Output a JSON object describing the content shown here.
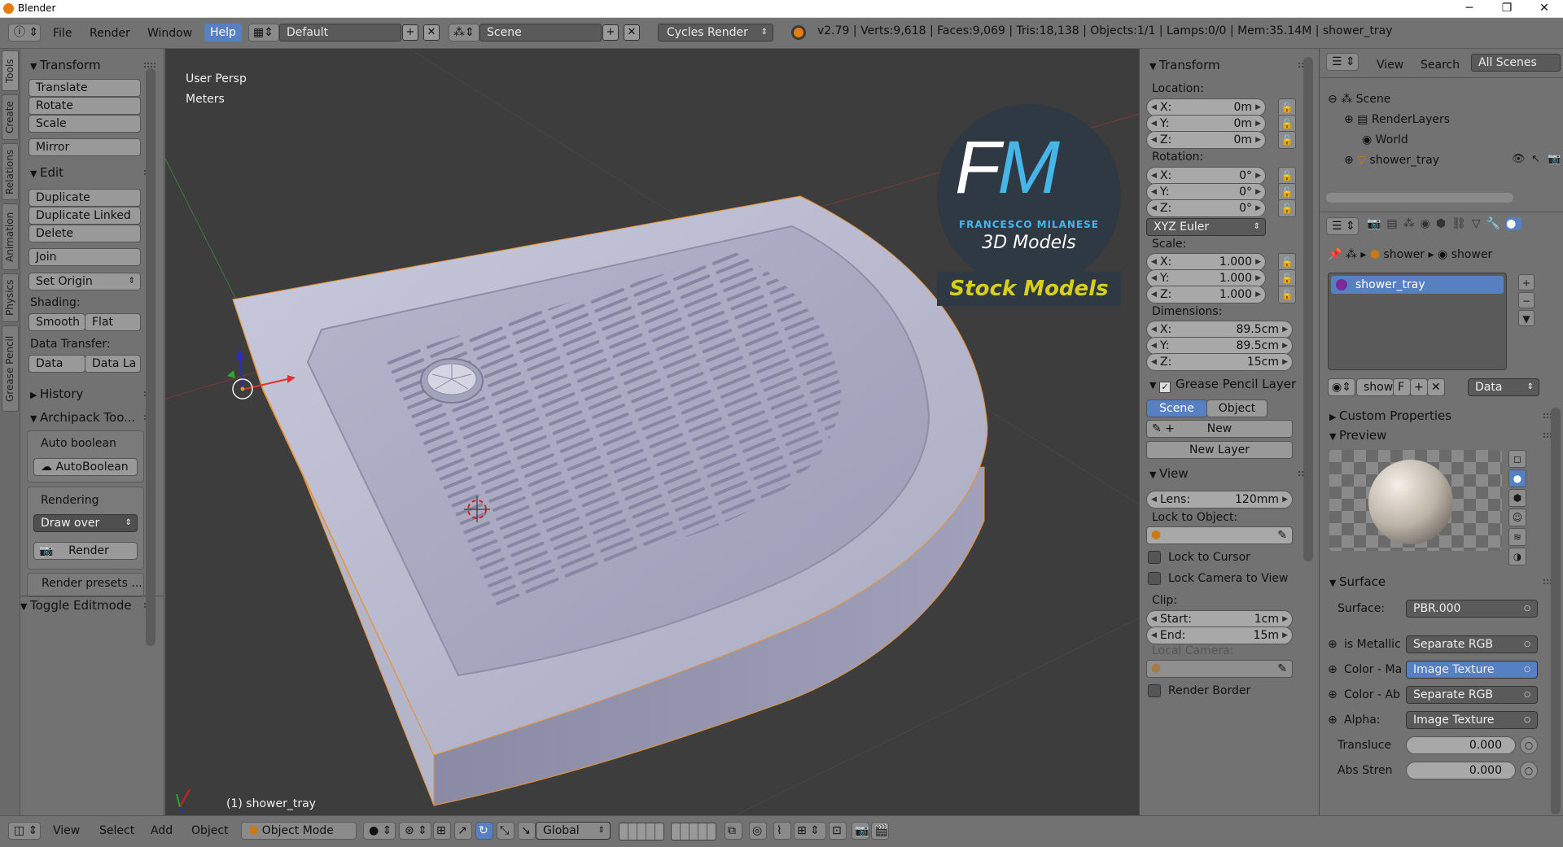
{
  "window": {
    "title": "Blender",
    "minimize": "─",
    "maximize": "❐",
    "close": "✕"
  },
  "menu": {
    "items": [
      "File",
      "Render",
      "Window",
      "Help"
    ],
    "active": "Help"
  },
  "screen_layout": "Default",
  "scene": "Scene",
  "render_engine": "Cycles Render",
  "stats": "v2.79 | Verts:9,618 | Faces:9,069 | Tris:18,138 | Objects:1/1 | Lamps:0/0 | Mem:35.14M | shower_tray",
  "vtabs": [
    "Tools",
    "Create",
    "Relations",
    "Animation",
    "Physics",
    "Grease Pencil"
  ],
  "tools": {
    "transform_header": "Transform",
    "translate": "Translate",
    "rotate": "Rotate",
    "scale": "Scale",
    "mirror": "Mirror",
    "edit_header": "Edit",
    "duplicate": "Duplicate",
    "duplicate_linked": "Duplicate Linked",
    "delete": "Delete",
    "join": "Join",
    "set_origin": "Set Origin",
    "shading_label": "Shading:",
    "smooth": "Smooth",
    "flat": "Flat",
    "data_transfer_label": "Data Transfer:",
    "data": "Data",
    "data_la": "Data La",
    "history_header": "History",
    "archipack_header": "Archipack Too...",
    "auto_boolean_label": "Auto boolean",
    "autoboolean_button": "AutoBoolean",
    "rendering_label": "Rendering",
    "draw_over": "Draw over",
    "render_button": "Render",
    "render_presets": "Render presets ...",
    "toggle_editmode": "Toggle Editmode"
  },
  "viewport": {
    "view_name": "User Persp",
    "units": "Meters",
    "object_label": "(1) shower_tray",
    "watermark_logo": "FM",
    "watermark_name": "FRANCESCO MILANESE",
    "watermark_sub": "3D Models",
    "watermark_stock": "Stock Models"
  },
  "nprops": {
    "transform_header": "Transform",
    "location_label": "Location:",
    "location": [
      {
        "k": "X:",
        "v": "0m"
      },
      {
        "k": "Y:",
        "v": "0m"
      },
      {
        "k": "Z:",
        "v": "0m"
      }
    ],
    "rotation_label": "Rotation:",
    "rotation": [
      {
        "k": "X:",
        "v": "0°"
      },
      {
        "k": "Y:",
        "v": "0°"
      },
      {
        "k": "Z:",
        "v": "0°"
      }
    ],
    "rotation_mode": "XYZ Euler",
    "scale_label": "Scale:",
    "scale": [
      {
        "k": "X:",
        "v": "1.000"
      },
      {
        "k": "Y:",
        "v": "1.000"
      },
      {
        "k": "Z:",
        "v": "1.000"
      }
    ],
    "dimensions_label": "Dimensions:",
    "dimensions": [
      {
        "k": "X:",
        "v": "89.5cm"
      },
      {
        "k": "Y:",
        "v": "89.5cm"
      },
      {
        "k": "Z:",
        "v": "15cm"
      }
    ],
    "grease_header": "Grease Pencil Layer",
    "gp_scene": "Scene",
    "gp_object": "Object",
    "gp_new": "New",
    "gp_new_layer": "New Layer",
    "view_header": "View",
    "lens_label": "Lens:",
    "lens_value": "120mm",
    "lock_object_label": "Lock to Object:",
    "lock_cursor": "Lock to Cursor",
    "lock_camera": "Lock Camera to View",
    "clip_label": "Clip:",
    "clip_start_label": "Start:",
    "clip_start": "1cm",
    "clip_end_label": "End:",
    "clip_end": "15m",
    "local_camera_label": "Local Camera:",
    "render_border": "Render Border"
  },
  "outliner": {
    "view": "View",
    "search": "Search",
    "filter": "All Scenes",
    "rows": [
      "Scene",
      "RenderLayers",
      "World",
      "shower_tray"
    ]
  },
  "properties": {
    "breadcrumb1": "shower",
    "breadcrumb2": "shower",
    "material_slot": "shower_tray",
    "mat_name": "show",
    "mat_f": "F",
    "data_select": "Data",
    "custom_props": "Custom Properties",
    "preview": "Preview",
    "surface_header": "Surface",
    "surface_label": "Surface:",
    "surface_value": "PBR.000",
    "inputs": [
      {
        "label": "is Metallic",
        "value": "Separate RGB"
      },
      {
        "label": "Color - Ma",
        "value": "Image Texture"
      },
      {
        "label": "Color - Ab",
        "value": "Separate RGB"
      },
      {
        "label": "Alpha:",
        "value": "Image Texture"
      }
    ],
    "translucent_label": "Transluce",
    "translucent_value": "0.000",
    "abs_label": "Abs Stren",
    "abs_value": "0.000"
  },
  "bottombar": {
    "view": "View",
    "select": "Select",
    "add": "Add",
    "object": "Object",
    "mode": "Object Mode",
    "orientation": "Global"
  }
}
